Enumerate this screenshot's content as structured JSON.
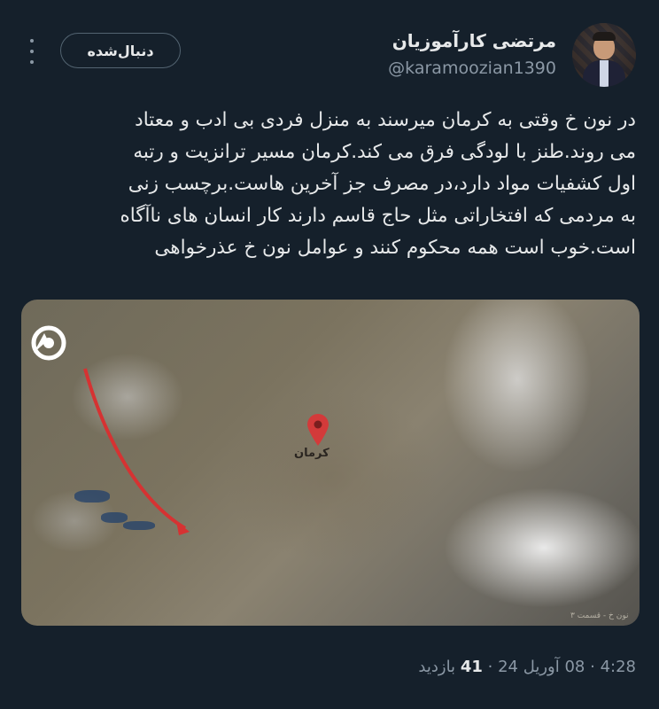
{
  "author": {
    "name": "مرتضی کارآموزیان",
    "handle": "@karamoozian1390"
  },
  "actions": {
    "follow_label": "دنبال‌شده",
    "more_icon": "more-dots-icon"
  },
  "tweet": {
    "text": "در نون خ وقتی به کرمان میرسند به منزل فردی بی ادب و معتاد\nمی روند.طنز با لودگی فرق می کند.کرمان مسیر ترانزیت و رتبه\nاول کشفیات مواد دارد،در مصرف جز آخرین هاست.برچسب زنی\nبه مردمی که افتخاراتی مثل حاج قاسم دارند کار انسان های ناآگاه\nاست.خوب است همه محکوم کنند و عوامل نون خ عذرخواهی"
  },
  "media": {
    "city_label": "کرمان",
    "caption": "نون خ - قسمت ۳",
    "pin_color": "#d33a3a",
    "arrow_color": "#d63232"
  },
  "meta": {
    "time": "4:28",
    "separator": "·",
    "date": "08 آوریل 24",
    "views_count": "41",
    "views_label": "بازدید"
  },
  "colors": {
    "background": "#15202b",
    "text": "#e7e9ea",
    "muted": "#8b98a5"
  }
}
